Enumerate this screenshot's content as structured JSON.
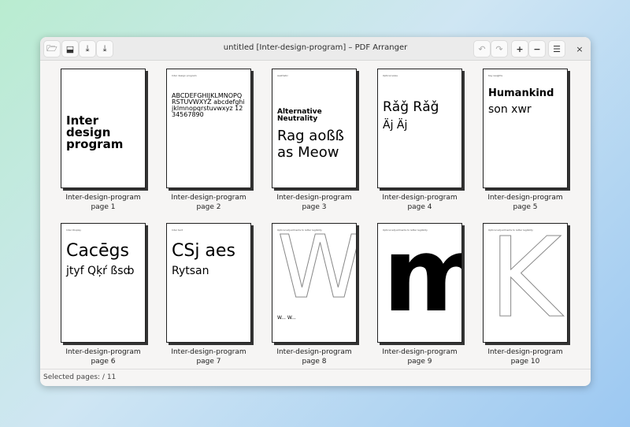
{
  "window": {
    "title": "untitled [Inter-design-program] – PDF Arranger"
  },
  "toolbar": {
    "left": [
      {
        "icon": "open-icon",
        "glyph": "🗁"
      },
      {
        "icon": "import-icon",
        "glyph": "⬓"
      },
      {
        "icon": "save-icon",
        "glyph": "⤓"
      },
      {
        "icon": "save-as-icon",
        "glyph": "⤓"
      }
    ],
    "right": [
      {
        "icon": "undo-icon",
        "glyph": "↶"
      },
      {
        "icon": "redo-icon",
        "glyph": "↷"
      },
      {
        "icon": "zoom-in-icon",
        "glyph": "+"
      },
      {
        "icon": "zoom-out-icon",
        "glyph": "−"
      },
      {
        "icon": "menu-icon",
        "glyph": "☰"
      }
    ],
    "close": "×"
  },
  "pages": [
    {
      "name": "Inter-design-program",
      "label": "page 1",
      "heading": "",
      "main": "Inter design program"
    },
    {
      "name": "Inter-design-program",
      "label": "page 2",
      "heading": "Inter design program",
      "main": "ABCDEFGHIJKLMNOPQRSTUVWXYZ abcdefghijklmnopqrstuvwxyz 1234567890"
    },
    {
      "name": "Inter-design-program",
      "label": "page 3",
      "heading": "Aesthetic",
      "main": "Alternative Neutrality",
      "extra": "Rag aoßß  as  Meow"
    },
    {
      "name": "Inter-design-program",
      "label": "page 4",
      "heading": "Optical sizes",
      "main": "Rǎǧ Rǎǧ",
      "extra": "Äj Äj"
    },
    {
      "name": "Inter-design-program",
      "label": "page 5",
      "heading": "Key weights",
      "main": "Humankind",
      "extra": "son xwr"
    },
    {
      "name": "Inter-design-program",
      "label": "page 6",
      "heading": "Inter Display",
      "main": "Cacēgs",
      "extra": "jtyf Qķŕ ßsȸ"
    },
    {
      "name": "Inter-design-program",
      "label": "page 7",
      "heading": "Inter text",
      "main": "CSj aes",
      "extra": "Rytsan"
    },
    {
      "name": "Inter-design-program",
      "label": "page 8",
      "heading": "Optical adjustments to letter legibility",
      "main": "W",
      "extra": "W... W..."
    },
    {
      "name": "Inter-design-program",
      "label": "page 9",
      "heading": "Optical adjustments to letter legibility",
      "main": "m",
      "extra": ""
    },
    {
      "name": "Inter-design-program",
      "label": "page 10",
      "heading": "Optical adjustments to letter legibility",
      "main": "K",
      "extra": ""
    }
  ],
  "status": {
    "text": "Selected pages:  / 11"
  }
}
